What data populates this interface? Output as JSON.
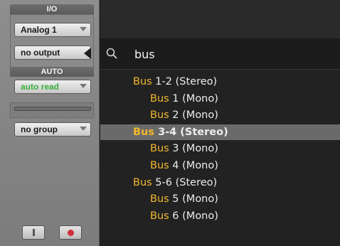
{
  "io": {
    "title": "I/O",
    "input": "Analog 1",
    "output": "no output"
  },
  "auto": {
    "title": "AUTO",
    "mode": "auto read",
    "mode_color": "#39b03a"
  },
  "group": {
    "value": "no group"
  },
  "buttons": [
    {
      "icon": "input-monitor-icon"
    },
    {
      "icon": "record-enable-icon",
      "color": "#d22d3a"
    }
  ],
  "search": {
    "icon": "magnifier-icon",
    "query": "bus"
  },
  "highlight_color": "#f3b72f",
  "results": [
    {
      "match": "Bus",
      "rest": " 1-2 (Stereo)",
      "indent": 0,
      "selected": false
    },
    {
      "match": "Bus",
      "rest": " 1 (Mono)",
      "indent": 1,
      "selected": false
    },
    {
      "match": "Bus",
      "rest": " 2 (Mono)",
      "indent": 1,
      "selected": false
    },
    {
      "match": "Bus",
      "rest": " 3-4 (Stereo)",
      "indent": 0,
      "selected": true
    },
    {
      "match": "Bus",
      "rest": " 3 (Mono)",
      "indent": 1,
      "selected": false
    },
    {
      "match": "Bus",
      "rest": " 4 (Mono)",
      "indent": 1,
      "selected": false
    },
    {
      "match": "Bus",
      "rest": " 5-6 (Stereo)",
      "indent": 0,
      "selected": false
    },
    {
      "match": "Bus",
      "rest": " 5 (Mono)",
      "indent": 1,
      "selected": false
    },
    {
      "match": "Bus",
      "rest": " 6 (Mono)",
      "indent": 1,
      "selected": false
    }
  ]
}
